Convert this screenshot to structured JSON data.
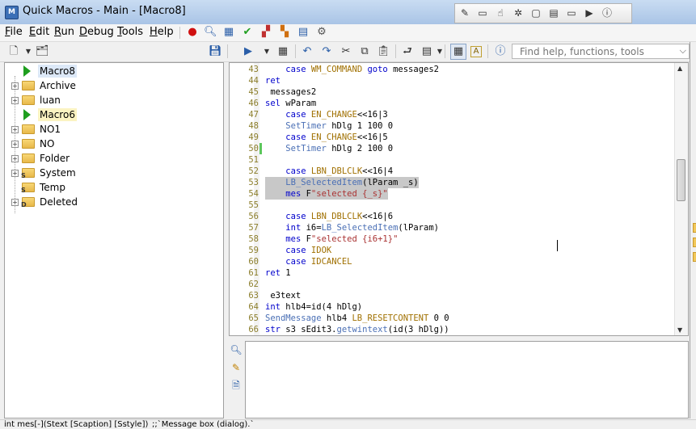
{
  "window": {
    "title": "Quick Macros - Main - [Macro8]",
    "app_icon": "M"
  },
  "menu": {
    "items": [
      {
        "key": "F",
        "rest": "ile"
      },
      {
        "key": "E",
        "rest": "dit"
      },
      {
        "key": "R",
        "rest": "un"
      },
      {
        "key": "D",
        "rest": "ebug"
      },
      {
        "key": "T",
        "rest": "ools"
      },
      {
        "key": "H",
        "rest": "elp"
      }
    ],
    "icons": [
      "record-icon",
      "find-icon",
      "calendar-icon",
      "check-icon",
      "components-icon",
      "properties-icon",
      "gear-clock-icon"
    ]
  },
  "search": {
    "placeholder": "Find help, functions, tools"
  },
  "tree": {
    "items": [
      {
        "label": "Macro8",
        "type": "macro",
        "expandable": false,
        "highlight": "blue"
      },
      {
        "label": "Archive",
        "type": "folder",
        "expandable": true,
        "highlight": ""
      },
      {
        "label": "luan",
        "type": "folder",
        "expandable": true,
        "highlight": ""
      },
      {
        "label": "Macro6",
        "type": "macro",
        "expandable": false,
        "highlight": "yellow"
      },
      {
        "label": "NO1",
        "type": "folder",
        "expandable": true,
        "highlight": ""
      },
      {
        "label": "NO",
        "type": "folder",
        "expandable": true,
        "highlight": ""
      },
      {
        "label": "Folder",
        "type": "folder",
        "expandable": true,
        "highlight": ""
      },
      {
        "label": "System",
        "type": "folder-system",
        "expandable": true,
        "highlight": ""
      },
      {
        "label": "Temp",
        "type": "folder-system",
        "expandable": false,
        "highlight": ""
      },
      {
        "label": "Deleted",
        "type": "folder-deleted",
        "expandable": true,
        "highlight": ""
      }
    ]
  },
  "editor": {
    "lines": [
      {
        "n": "43",
        "code": "    case WM_COMMAND goto messages2"
      },
      {
        "n": "44",
        "code": "ret"
      },
      {
        "n": "45",
        "code": " messages2"
      },
      {
        "n": "46",
        "code": "sel wParam"
      },
      {
        "n": "47",
        "code": "    case EN_CHANGE<<16|3"
      },
      {
        "n": "48",
        "code": "    SetTimer hDlg 1 100 0"
      },
      {
        "n": "49",
        "code": "    case EN_CHANGE<<16|5"
      },
      {
        "n": "50",
        "code": "    SetTimer hDlg 2 100 0"
      },
      {
        "n": "51",
        "code": ""
      },
      {
        "n": "52",
        "code": "    case LBN_DBLCLK<<16|4"
      },
      {
        "n": "53",
        "code": "    LB_SelectedItem(lParam _s)"
      },
      {
        "n": "54",
        "code": "    mes F\"selected {_s}\""
      },
      {
        "n": "55",
        "code": ""
      },
      {
        "n": "56",
        "code": "    case LBN_DBLCLK<<16|6"
      },
      {
        "n": "57",
        "code": "    int i6=LB_SelectedItem(lParam)"
      },
      {
        "n": "58",
        "code": "    mes F\"selected {i6+1}\""
      },
      {
        "n": "59",
        "code": "    case IDOK"
      },
      {
        "n": "60",
        "code": "    case IDCANCEL"
      },
      {
        "n": "61",
        "code": "ret 1"
      },
      {
        "n": "62",
        "code": ""
      },
      {
        "n": "63",
        "code": " e3text"
      },
      {
        "n": "64",
        "code": "int hlb4=id(4 hDlg)"
      },
      {
        "n": "65",
        "code": "SendMessage hlb4 LB_RESETCONTENT 0 0"
      },
      {
        "n": "66",
        "code": "str s3 sEdit3.getwintext(id(3 hDlg))"
      }
    ]
  },
  "status": {
    "signature": "int mes[-](Stext [Scaption] [Sstyle])",
    "description": ";;`Message box (dialog).`"
  }
}
